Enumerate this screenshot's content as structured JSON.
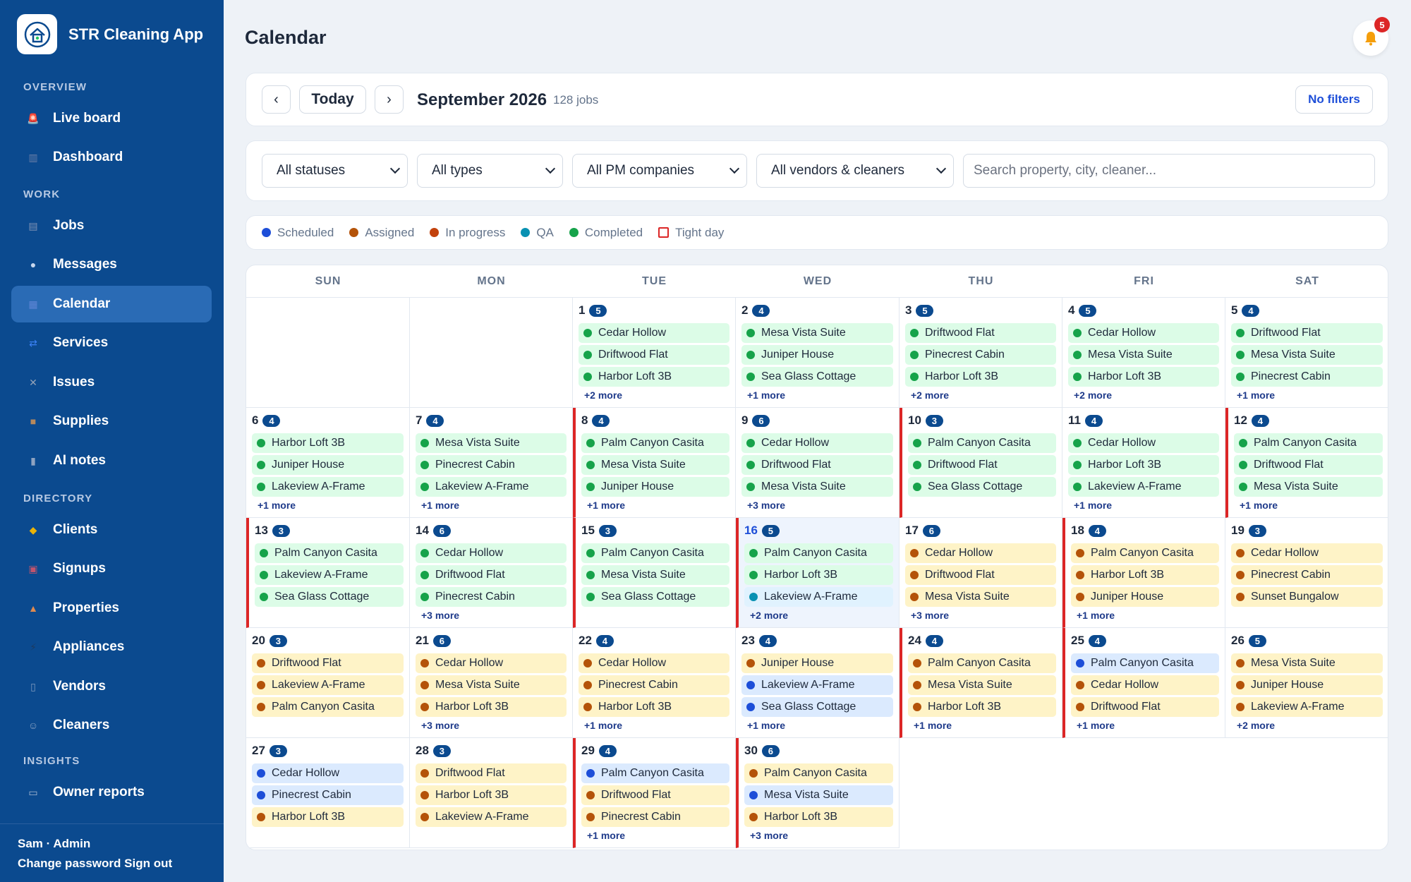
{
  "app": {
    "title": "STR Cleaning App"
  },
  "sidebar": {
    "sections": [
      {
        "label": "OVERVIEW",
        "items": [
          {
            "label": "Live board",
            "icon": "siren-icon",
            "active": false
          },
          {
            "label": "Dashboard",
            "icon": "bar-chart-icon",
            "active": false
          }
        ]
      },
      {
        "label": "WORK",
        "items": [
          {
            "label": "Jobs",
            "icon": "clipboard-icon",
            "active": false
          },
          {
            "label": "Messages",
            "icon": "chat-bubble-icon",
            "active": false
          },
          {
            "label": "Calendar",
            "icon": "calendar-icon",
            "active": true
          },
          {
            "label": "Services",
            "icon": "services-icon",
            "active": false
          },
          {
            "label": "Issues",
            "icon": "tools-icon",
            "active": false
          },
          {
            "label": "Supplies",
            "icon": "box-icon",
            "active": false
          },
          {
            "label": "AI notes",
            "icon": "microphone-icon",
            "active": false
          }
        ]
      },
      {
        "label": "DIRECTORY",
        "items": [
          {
            "label": "Clients",
            "icon": "handshake-icon",
            "active": false
          },
          {
            "label": "Signups",
            "icon": "inbox-icon",
            "active": false
          },
          {
            "label": "Properties",
            "icon": "house-icon",
            "active": false
          },
          {
            "label": "Appliances",
            "icon": "plug-icon",
            "active": false
          },
          {
            "label": "Vendors",
            "icon": "building-icon",
            "active": false
          },
          {
            "label": "Cleaners",
            "icon": "person-icon",
            "active": false
          }
        ]
      },
      {
        "label": "INSIGHTS",
        "items": [
          {
            "label": "Owner reports",
            "icon": "document-icon",
            "active": false
          }
        ]
      }
    ],
    "user": "Sam · Admin",
    "change_password": "Change password",
    "sign_out": "Sign out"
  },
  "header": {
    "title": "Calendar",
    "notifications": "5"
  },
  "toolbar": {
    "prev": "‹",
    "today": "Today",
    "next": "›",
    "month": "September 2026",
    "job_count": "128 jobs",
    "filters_label": "No filters"
  },
  "filters": {
    "status": "All statuses",
    "type": "All types",
    "pm": "All PM companies",
    "vendor": "All vendors & cleaners",
    "search_placeholder": "Search property, city, cleaner..."
  },
  "legend": [
    {
      "label": "Scheduled",
      "color": "#1d4ed8"
    },
    {
      "label": "Assigned",
      "color": "#b45309"
    },
    {
      "label": "In progress",
      "color": "#c2410c"
    },
    {
      "label": "QA",
      "color": "#0891b2"
    },
    {
      "label": "Completed",
      "color": "#16a34a"
    },
    {
      "label": "Tight day",
      "color": "#dc2626"
    }
  ],
  "calendar": {
    "weekdays": [
      "SUN",
      "MON",
      "TUE",
      "WED",
      "THU",
      "FRI",
      "SAT"
    ],
    "first_weekday": 2,
    "days": [
      {
        "day": "1",
        "count": "5",
        "tight": false,
        "today": false,
        "jobs": [
          [
            "Cedar Hollow",
            "completed"
          ],
          [
            "Driftwood Flat",
            "completed"
          ],
          [
            "Harbor Loft 3B",
            "completed"
          ]
        ],
        "more": "+2 more"
      },
      {
        "day": "2",
        "count": "4",
        "tight": false,
        "today": false,
        "jobs": [
          [
            "Mesa Vista Suite",
            "completed"
          ],
          [
            "Juniper House",
            "completed"
          ],
          [
            "Sea Glass Cottage",
            "completed"
          ]
        ],
        "more": "+1 more"
      },
      {
        "day": "3",
        "count": "5",
        "tight": false,
        "today": false,
        "jobs": [
          [
            "Driftwood Flat",
            "completed"
          ],
          [
            "Pinecrest Cabin",
            "completed"
          ],
          [
            "Harbor Loft 3B",
            "completed"
          ]
        ],
        "more": "+2 more"
      },
      {
        "day": "4",
        "count": "5",
        "tight": false,
        "today": false,
        "jobs": [
          [
            "Cedar Hollow",
            "completed"
          ],
          [
            "Mesa Vista Suite",
            "completed"
          ],
          [
            "Harbor Loft 3B",
            "completed"
          ]
        ],
        "more": "+2 more"
      },
      {
        "day": "5",
        "count": "4",
        "tight": false,
        "today": false,
        "jobs": [
          [
            "Driftwood Flat",
            "completed"
          ],
          [
            "Mesa Vista Suite",
            "completed"
          ],
          [
            "Pinecrest Cabin",
            "completed"
          ]
        ],
        "more": "+1 more"
      },
      {
        "day": "6",
        "count": "4",
        "tight": false,
        "today": false,
        "jobs": [
          [
            "Harbor Loft 3B",
            "completed"
          ],
          [
            "Juniper House",
            "completed"
          ],
          [
            "Lakeview A-Frame",
            "completed"
          ]
        ],
        "more": "+1 more"
      },
      {
        "day": "7",
        "count": "4",
        "tight": false,
        "today": false,
        "jobs": [
          [
            "Mesa Vista Suite",
            "completed"
          ],
          [
            "Pinecrest Cabin",
            "completed"
          ],
          [
            "Lakeview A-Frame",
            "completed"
          ]
        ],
        "more": "+1 more"
      },
      {
        "day": "8",
        "count": "4",
        "tight": true,
        "today": false,
        "jobs": [
          [
            "Palm Canyon Casita",
            "completed"
          ],
          [
            "Mesa Vista Suite",
            "completed"
          ],
          [
            "Juniper House",
            "completed"
          ]
        ],
        "more": "+1 more"
      },
      {
        "day": "9",
        "count": "6",
        "tight": false,
        "today": false,
        "jobs": [
          [
            "Cedar Hollow",
            "completed"
          ],
          [
            "Driftwood Flat",
            "completed"
          ],
          [
            "Mesa Vista Suite",
            "completed"
          ]
        ],
        "more": "+3 more"
      },
      {
        "day": "10",
        "count": "3",
        "tight": true,
        "today": false,
        "jobs": [
          [
            "Palm Canyon Casita",
            "completed"
          ],
          [
            "Driftwood Flat",
            "completed"
          ],
          [
            "Sea Glass Cottage",
            "completed"
          ]
        ],
        "more": ""
      },
      {
        "day": "11",
        "count": "4",
        "tight": false,
        "today": false,
        "jobs": [
          [
            "Cedar Hollow",
            "completed"
          ],
          [
            "Harbor Loft 3B",
            "completed"
          ],
          [
            "Lakeview A-Frame",
            "completed"
          ]
        ],
        "more": "+1 more"
      },
      {
        "day": "12",
        "count": "4",
        "tight": true,
        "today": false,
        "jobs": [
          [
            "Palm Canyon Casita",
            "completed"
          ],
          [
            "Driftwood Flat",
            "completed"
          ],
          [
            "Mesa Vista Suite",
            "completed"
          ]
        ],
        "more": "+1 more"
      },
      {
        "day": "13",
        "count": "3",
        "tight": true,
        "today": false,
        "jobs": [
          [
            "Palm Canyon Casita",
            "completed"
          ],
          [
            "Lakeview A-Frame",
            "completed"
          ],
          [
            "Sea Glass Cottage",
            "completed"
          ]
        ],
        "more": ""
      },
      {
        "day": "14",
        "count": "6",
        "tight": false,
        "today": false,
        "jobs": [
          [
            "Cedar Hollow",
            "completed"
          ],
          [
            "Driftwood Flat",
            "completed"
          ],
          [
            "Pinecrest Cabin",
            "completed"
          ]
        ],
        "more": "+3 more"
      },
      {
        "day": "15",
        "count": "3",
        "tight": true,
        "today": false,
        "jobs": [
          [
            "Palm Canyon Casita",
            "completed"
          ],
          [
            "Mesa Vista Suite",
            "completed"
          ],
          [
            "Sea Glass Cottage",
            "completed"
          ]
        ],
        "more": ""
      },
      {
        "day": "16",
        "count": "5",
        "tight": true,
        "today": true,
        "jobs": [
          [
            "Palm Canyon Casita",
            "completed"
          ],
          [
            "Harbor Loft 3B",
            "completed"
          ],
          [
            "Lakeview A-Frame",
            "qa"
          ]
        ],
        "more": "+2 more"
      },
      {
        "day": "17",
        "count": "6",
        "tight": false,
        "today": false,
        "jobs": [
          [
            "Cedar Hollow",
            "assigned"
          ],
          [
            "Driftwood Flat",
            "assigned"
          ],
          [
            "Mesa Vista Suite",
            "assigned"
          ]
        ],
        "more": "+3 more"
      },
      {
        "day": "18",
        "count": "4",
        "tight": true,
        "today": false,
        "jobs": [
          [
            "Palm Canyon Casita",
            "assigned"
          ],
          [
            "Harbor Loft 3B",
            "assigned"
          ],
          [
            "Juniper House",
            "assigned"
          ]
        ],
        "more": "+1 more"
      },
      {
        "day": "19",
        "count": "3",
        "tight": false,
        "today": false,
        "jobs": [
          [
            "Cedar Hollow",
            "assigned"
          ],
          [
            "Pinecrest Cabin",
            "assigned"
          ],
          [
            "Sunset Bungalow",
            "assigned"
          ]
        ],
        "more": ""
      },
      {
        "day": "20",
        "count": "3",
        "tight": false,
        "today": false,
        "jobs": [
          [
            "Driftwood Flat",
            "assigned"
          ],
          [
            "Lakeview A-Frame",
            "assigned"
          ],
          [
            "Palm Canyon Casita",
            "assigned"
          ]
        ],
        "more": ""
      },
      {
        "day": "21",
        "count": "6",
        "tight": false,
        "today": false,
        "jobs": [
          [
            "Cedar Hollow",
            "assigned"
          ],
          [
            "Mesa Vista Suite",
            "assigned"
          ],
          [
            "Harbor Loft 3B",
            "assigned"
          ]
        ],
        "more": "+3 more"
      },
      {
        "day": "22",
        "count": "4",
        "tight": false,
        "today": false,
        "jobs": [
          [
            "Cedar Hollow",
            "assigned"
          ],
          [
            "Pinecrest Cabin",
            "assigned"
          ],
          [
            "Harbor Loft 3B",
            "assigned"
          ]
        ],
        "more": "+1 more"
      },
      {
        "day": "23",
        "count": "4",
        "tight": false,
        "today": false,
        "jobs": [
          [
            "Juniper House",
            "assigned"
          ],
          [
            "Lakeview A-Frame",
            "scheduled"
          ],
          [
            "Sea Glass Cottage",
            "scheduled"
          ]
        ],
        "more": "+1 more"
      },
      {
        "day": "24",
        "count": "4",
        "tight": true,
        "today": false,
        "jobs": [
          [
            "Palm Canyon Casita",
            "assigned"
          ],
          [
            "Mesa Vista Suite",
            "assigned"
          ],
          [
            "Harbor Loft 3B",
            "assigned"
          ]
        ],
        "more": "+1 more"
      },
      {
        "day": "25",
        "count": "4",
        "tight": true,
        "today": false,
        "jobs": [
          [
            "Palm Canyon Casita",
            "scheduled"
          ],
          [
            "Cedar Hollow",
            "assigned"
          ],
          [
            "Driftwood Flat",
            "assigned"
          ]
        ],
        "more": "+1 more"
      },
      {
        "day": "26",
        "count": "5",
        "tight": false,
        "today": false,
        "jobs": [
          [
            "Mesa Vista Suite",
            "assigned"
          ],
          [
            "Juniper House",
            "assigned"
          ],
          [
            "Lakeview A-Frame",
            "assigned"
          ]
        ],
        "more": "+2 more"
      },
      {
        "day": "27",
        "count": "3",
        "tight": false,
        "today": false,
        "jobs": [
          [
            "Cedar Hollow",
            "scheduled"
          ],
          [
            "Pinecrest Cabin",
            "scheduled"
          ],
          [
            "Harbor Loft 3B",
            "assigned"
          ]
        ],
        "more": ""
      },
      {
        "day": "28",
        "count": "3",
        "tight": false,
        "today": false,
        "jobs": [
          [
            "Driftwood Flat",
            "assigned"
          ],
          [
            "Harbor Loft 3B",
            "assigned"
          ],
          [
            "Lakeview A-Frame",
            "assigned"
          ]
        ],
        "more": ""
      },
      {
        "day": "29",
        "count": "4",
        "tight": true,
        "today": false,
        "jobs": [
          [
            "Palm Canyon Casita",
            "scheduled"
          ],
          [
            "Driftwood Flat",
            "assigned"
          ],
          [
            "Pinecrest Cabin",
            "assigned"
          ]
        ],
        "more": "+1 more"
      },
      {
        "day": "30",
        "count": "6",
        "tight": true,
        "today": false,
        "jobs": [
          [
            "Palm Canyon Casita",
            "assigned"
          ],
          [
            "Mesa Vista Suite",
            "scheduled"
          ],
          [
            "Harbor Loft 3B",
            "assigned"
          ]
        ],
        "more": "+3 more"
      }
    ]
  }
}
